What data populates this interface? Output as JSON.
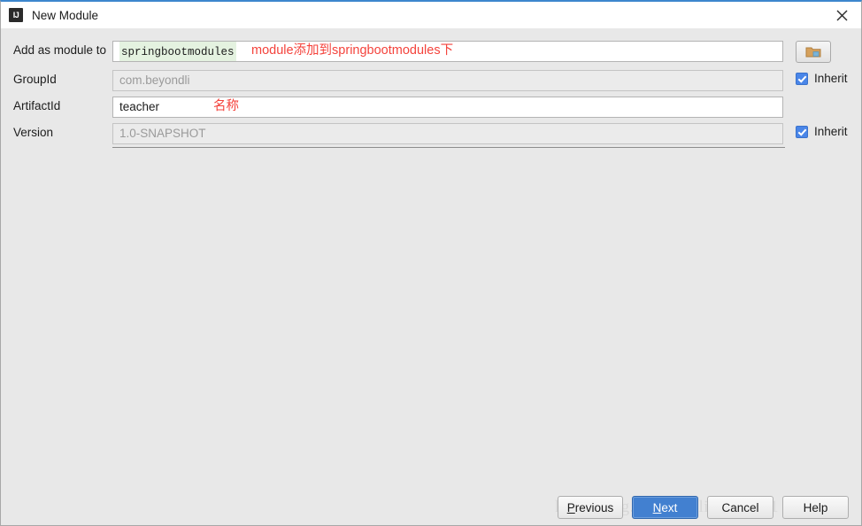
{
  "window": {
    "title": "New Module",
    "app_icon": "IJ",
    "close_icon": "close-icon",
    "accent_color": "#3c86cd"
  },
  "form": {
    "rows": [
      {
        "label": "Add as module to",
        "value": "springbootmodules",
        "state": "token",
        "annotation": "module添加到springbootmodules下"
      },
      {
        "label": "GroupId",
        "value": "com.beyondli",
        "state": "disabled",
        "annotation": ""
      },
      {
        "label": "ArtifactId",
        "value": "teacher",
        "state": "editable",
        "annotation": "名称"
      },
      {
        "label": "Version",
        "value": "1.0-SNAPSHOT",
        "state": "disabled",
        "annotation": ""
      }
    ],
    "browse_button": {
      "name": "browse-folder-button",
      "icon": "folder-icon"
    },
    "inherit_groupid": {
      "label": "Inherit",
      "checked": true
    },
    "inherit_version": {
      "label": "Inherit",
      "checked": true
    }
  },
  "buttons": {
    "previous": {
      "prefix": "",
      "mnemonic": "P",
      "suffix": "revious"
    },
    "next": {
      "prefix": "",
      "mnemonic": "N",
      "suffix": "ext"
    },
    "cancel": {
      "prefix": "",
      "mnemonic": "",
      "suffix": "Cancel"
    },
    "help": {
      "prefix": "",
      "mnemonic": "",
      "suffix": "Help"
    }
  },
  "watermark": {
    "text": "http://blog.csdn.net/liboyang71"
  },
  "colors": {
    "default_button": "#4280d0",
    "annotation_red": "#f4433c",
    "token_highlight": "#e4f2e0",
    "checkbox_blue": "#4a86e8"
  }
}
